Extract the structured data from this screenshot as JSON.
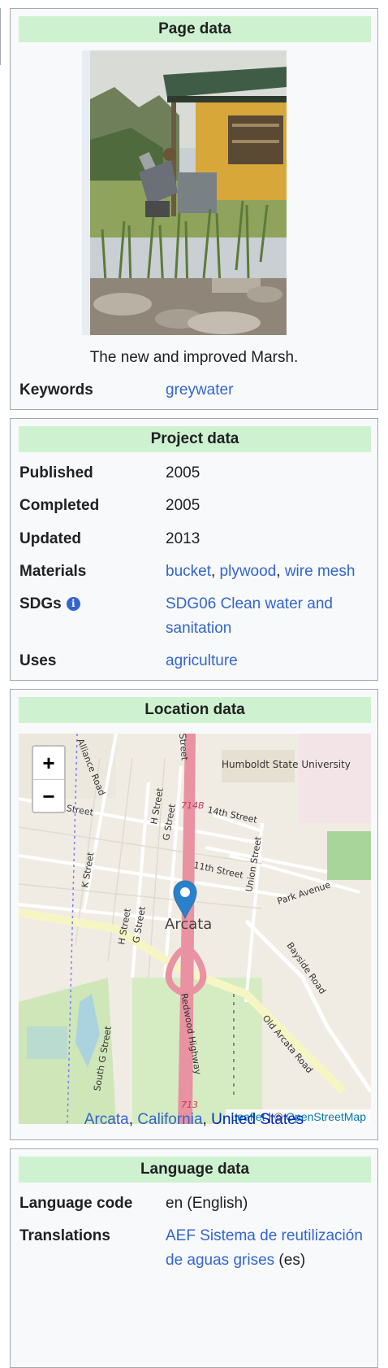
{
  "page_box": {
    "title": "Page data",
    "caption": "The new and improved Marsh.",
    "keywords_label": "Keywords",
    "keywords_value": "greywater"
  },
  "project_box": {
    "title": "Project data",
    "published_label": "Published",
    "published_value": "2005",
    "completed_label": "Completed",
    "completed_value": "2005",
    "updated_label": "Updated",
    "updated_value": "2013",
    "materials_label": "Materials",
    "materials": [
      "bucket",
      "plywood",
      "wire mesh"
    ],
    "sdgs_label": "SDGs",
    "sdgs_value": "SDG06 Clean water and sanitation",
    "uses_label": "Uses",
    "uses_value": "agriculture"
  },
  "location_box": {
    "title": "Location data",
    "zoom_in": "+",
    "zoom_out": "−",
    "attribution_leaflet": "Leaflet",
    "attribution_sep": " | © ",
    "attribution_osm": "OpenStreetMap",
    "map_labels": {
      "city": "Arcata",
      "university": "Humboldt State University",
      "s11": "11th Street",
      "s11b": "11th Street",
      "s14": "14th Street",
      "kst": "K Street",
      "hst": "H Street",
      "gst": "G Street",
      "hst2": "H Street",
      "gst2": "G Street",
      "union": "Union Street",
      "park": "Park Avenue",
      "bayside": "Bayside Road",
      "oldarcata": "Old Arcata Road",
      "redwood": "Redwood Highway",
      "southg": "South G Street",
      "alliance": "Alliance Road",
      "street": "Street",
      "r714": "714B",
      "r713": "713"
    },
    "loc_city": "Arcata",
    "loc_state": "California",
    "loc_country": "United States"
  },
  "language_box": {
    "title": "Language data",
    "code_label": "Language code",
    "code_value": "en (English)",
    "translations_label": "Translations",
    "translation_link": "AEF Sistema de reutilización de aguas grises",
    "translation_lang": " (es)"
  },
  "colors": {
    "header_bg": "#cef2d0",
    "link": "#3366cc",
    "box_bg": "#f8f9fa",
    "marker": "#2a81cb"
  },
  "icons": [
    "info-icon",
    "map-marker-icon",
    "zoom-in-icon",
    "zoom-out-icon"
  ]
}
